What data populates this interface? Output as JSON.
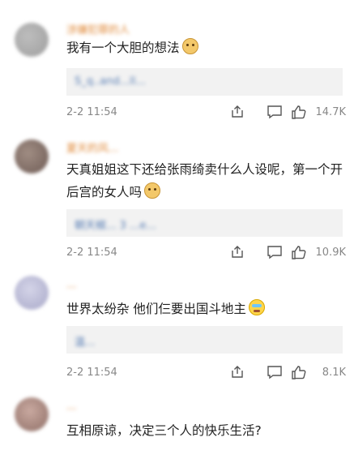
{
  "comments": [
    {
      "username": "涉嫌犯罪的人",
      "text": "我有一个大胆的想法",
      "emoji": "doge-icon",
      "reply_preview": "S_q..and...ll...",
      "time": "2-2 11:54",
      "likes": "14.7K"
    },
    {
      "username": "夏天的风...",
      "text": "天真姐姐这下还给张雨绮卖什么人设呢，第一个开后宫的女人吗",
      "emoji": "doge-icon",
      "reply_preview": "朝天椒... 3 ...e...",
      "time": "2-2 11:54",
      "likes": "10.9K"
    },
    {
      "username": "...",
      "text": "世界太纷杂 他们仨要出国斗地主",
      "emoji": "cry-laugh-icon",
      "reply_preview": "温...",
      "time": "2-2 11:54",
      "likes": "8.1K"
    },
    {
      "username": "...",
      "text": "互相原谅，决定三个人的快乐生活?",
      "emoji": "",
      "reply_preview": "",
      "time": "",
      "likes": ""
    }
  ],
  "colors": {
    "username": "#e08a3a",
    "reply_bg": "#f2f2f2",
    "meta": "#888888"
  }
}
